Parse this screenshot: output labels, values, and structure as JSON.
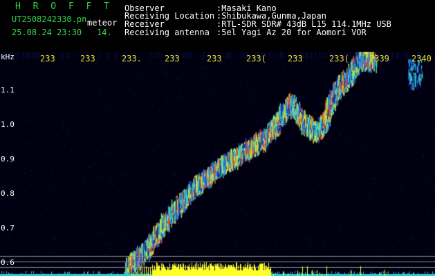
{
  "header": {
    "title": "H R O F F T",
    "file": "UT2508242330.pn",
    "mode": "meteor",
    "date_time": "25.08.24 23:30",
    "frame": "14.",
    "rows": [
      {
        "label": "Observer",
        "value": ":Masaki Kano"
      },
      {
        "label": "Receiving Location",
        "value": ":Shibukawa,Gunma,Japan"
      },
      {
        "label": "Receiver",
        "value": ":RTL-SDR SDR# 43dB L15 114.1MHz USB"
      },
      {
        "label": "Receiving antenna",
        "value": ":5el Yagi Az 20 for Aomori VOR"
      }
    ]
  },
  "spectrogram": {
    "unit": "kHz",
    "time_ticks": [
      "233",
      "233",
      "233.",
      "233",
      "233",
      "233(",
      "233",
      "233(",
      "2339",
      "2340"
    ],
    "freq_ticks": [
      "1.1",
      "1.0",
      "0.9",
      "0.8",
      "0.7",
      "0.6"
    ],
    "colors": {
      "background": "#000000",
      "header_green": "#33d64a",
      "tick_yellow": "#e8e028",
      "signal_yellow": "#ffff2a",
      "signal_cyan": "#32c8dc"
    }
  }
}
